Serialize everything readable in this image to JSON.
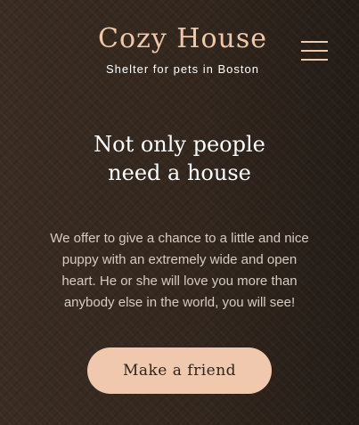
{
  "header": {
    "logo_title": "Cozy House",
    "logo_subtitle": "Shelter for pets in Boston",
    "menu_icon": "hamburger-menu-icon"
  },
  "hero": {
    "title_line1": "Not only people",
    "title_line2": "need a house",
    "description": "We offer to give a chance to a little and nice puppy with an extremely wide and open heart. He or she will love you more than anybody else in the world, you will see!",
    "cta_label": "Make a friend"
  },
  "colors": {
    "accent": "#f0c8ad",
    "background": "#2f241c",
    "text_light": "#ffffff",
    "text_muted": "#d6ccc4"
  }
}
